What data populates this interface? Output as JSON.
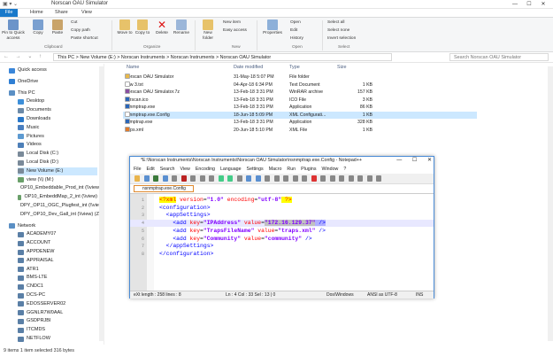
{
  "window": {
    "title": "Norscan OAU Simulator",
    "controls": [
      "—",
      "☐",
      "✕"
    ]
  },
  "ribbon_tabs": [
    "File",
    "Home",
    "Share",
    "View"
  ],
  "ribbon": {
    "pin_label": "Pin to Quick access",
    "copy_label": "Copy",
    "paste_label": "Paste",
    "cut_label": "Cut",
    "copy_path_label": "Copy path",
    "paste_shortcut_label": "Paste shortcut",
    "clipboard_group": "Clipboard",
    "move_to_label": "Move to",
    "copy_to_label": "Copy to",
    "delete_label": "Delete",
    "rename_label": "Rename",
    "organize_group": "Organize",
    "new_folder_label": "New folder",
    "new_item_label": "New item",
    "easy_access_label": "Easy access",
    "new_group": "New",
    "properties_label": "Properties",
    "open_label": "Open",
    "edit_label": "Edit",
    "history_label": "History",
    "open_group": "Open",
    "select_all_label": "Select all",
    "select_none_label": "Select none",
    "invert_selection_label": "Invert selection",
    "select_group": "Select"
  },
  "address": {
    "path": "This PC  >  New Volume (E:)  >  Norscan Instruments  >  Norscan Instruments  >  Norscan OAU Simulator",
    "search_placeholder": "Search Norscan OAU Simulator"
  },
  "nav": [
    {
      "label": "Quick access",
      "color": "#3a86d9"
    },
    {
      "label": "OneDrive",
      "color": "#2f7fd4"
    },
    {
      "label": "This PC",
      "color": "#5a8fc4"
    },
    {
      "label": "Desktop",
      "color": "#3d8fd9"
    },
    {
      "label": "Documents",
      "color": "#6c8aa8"
    },
    {
      "label": "Downloads",
      "color": "#2a78c9"
    },
    {
      "label": "Music",
      "color": "#4a7fc0"
    },
    {
      "label": "Pictures",
      "color": "#5d9ad1"
    },
    {
      "label": "Videos",
      "color": "#4d7fb8"
    },
    {
      "label": "Local Disk (C:)",
      "color": "#7a8a99"
    },
    {
      "label": "Local Disk (D:)",
      "color": "#7a8a99"
    },
    {
      "label": "New Volume (E:)",
      "color": "#7a8a99"
    },
    {
      "label": "view (\\\\) (M:)",
      "color": "#6aa06a"
    },
    {
      "label": "OP10_Embeddable_Prod_int (\\\\view)",
      "color": "#6aa06a"
    },
    {
      "label": "OP10_EmbeddMap_2_int (\\\\view)",
      "color": "#6aa06a"
    },
    {
      "label": "DPY_OP11_OGC_Plugfest_int (\\\\view)",
      "color": "#6aa06a"
    },
    {
      "label": "DPY_OP10_Dev_Gall_int (\\\\view) (Z:)",
      "color": "#6aa06a"
    },
    {
      "label": "Network",
      "color": "#5a8fc4"
    },
    {
      "label": "ACADEMY07",
      "color": "#5a7fa6"
    },
    {
      "label": "ACCOUNT",
      "color": "#5a7fa6"
    },
    {
      "label": "APPDENEW",
      "color": "#5a7fa6"
    },
    {
      "label": "APPRAISAL",
      "color": "#5a7fa6"
    },
    {
      "label": "ATR1",
      "color": "#5a7fa6"
    },
    {
      "label": "BMS-LTE",
      "color": "#5a7fa6"
    },
    {
      "label": "CNDC1",
      "color": "#5a7fa6"
    },
    {
      "label": "DCS-PC",
      "color": "#5a7fa6"
    },
    {
      "label": "EDOSSERVER02",
      "color": "#5a7fa6"
    },
    {
      "label": "GGNLR7W0AAL",
      "color": "#5a7fa6"
    },
    {
      "label": "GSDPRJBI",
      "color": "#5a7fa6"
    },
    {
      "label": "ITCMDS",
      "color": "#5a7fa6"
    },
    {
      "label": "NETFLOW",
      "color": "#5a7fa6"
    }
  ],
  "columns": [
    "Name",
    "Date modified",
    "Type",
    "Size"
  ],
  "files": [
    {
      "name": "Norscan OAU Simulator",
      "date": "31-May-18 5:07 PM",
      "type": "File folder",
      "size": "",
      "color": "#e8b84a"
    },
    {
      "name": "new 3.txt",
      "date": "04-Apr-18 6:34 PM",
      "type": "Text Document",
      "size": "1 KB",
      "color": "#ffffff"
    },
    {
      "name": "Norscan OAU Simulator.7z",
      "date": "13-Feb-18 3:31 PM",
      "type": "WinRAR archive",
      "size": "157 KB",
      "color": "#8a4fa0"
    },
    {
      "name": "norscan.ico",
      "date": "13-Feb-18 3:31 PM",
      "type": "ICO File",
      "size": "3 KB",
      "color": "#2a66b8"
    },
    {
      "name": "nsnmptrap.exe",
      "date": "13-Feb-18 3:31 PM",
      "type": "Application",
      "size": "86 KB",
      "color": "#2a66b8"
    },
    {
      "name": "nsnmptrap.exe.Config",
      "date": "18-Jun-18 5:09 PM",
      "type": "XML Configurati...",
      "size": "1 KB",
      "color": "#ffffff"
    },
    {
      "name": "snmptrap.exe",
      "date": "13-Feb-18 3:31 PM",
      "type": "Application",
      "size": "328 KB",
      "color": "#2a66b8"
    },
    {
      "name": "traps.xml",
      "date": "20-Jun-18 5:10 PM",
      "type": "XML File",
      "size": "1 KB",
      "color": "#e07a2a"
    }
  ],
  "status": "9 items    1 item selected  316 bytes",
  "notepad": {
    "title": "*E:\\Norscan Instruments\\Norscan Instruments\\Norscan OAU Simulator\\nsnmptrap.exe.Config - Notepad++",
    "menu": [
      "File",
      "Edit",
      "Search",
      "View",
      "Encoding",
      "Language",
      "Settings",
      "Macro",
      "Run",
      "Plugins",
      "Window",
      "?"
    ],
    "tab": "nsnmptrap.exe.Config",
    "lines": [
      {
        "n": "1",
        "indent": "",
        "tag1": "<?xml",
        "parts": [
          [
            " version",
            "=",
            "\"1.0\""
          ],
          [
            " encoding",
            "=",
            "\"utf-8\""
          ]
        ],
        "end": " ?>"
      },
      {
        "n": "2",
        "indent": "",
        "tag1": "<configuration>",
        "parts": [],
        "end": ""
      },
      {
        "n": "3",
        "indent": "  ",
        "tag1": "<appSettings>",
        "parts": [],
        "end": ""
      },
      {
        "n": "4",
        "indent": "    ",
        "tag1": "<add",
        "parts": [
          [
            " key",
            "=",
            "\"IPAddress\""
          ],
          [
            " value",
            "=",
            "\"172.16.129.37\""
          ]
        ],
        "end": " />"
      },
      {
        "n": "5",
        "indent": "    ",
        "tag1": "<add",
        "parts": [
          [
            " key",
            "=",
            "\"TrapsFileName\""
          ],
          [
            " value",
            "=",
            "\"traps.xml\""
          ]
        ],
        "end": " />"
      },
      {
        "n": "6",
        "indent": "    ",
        "tag1": "<add",
        "parts": [
          [
            " key",
            "=",
            "\"Community\""
          ],
          [
            " value",
            "=",
            "\"community\""
          ]
        ],
        "end": " />"
      },
      {
        "n": "7",
        "indent": "  ",
        "tag1": "</appSettings>",
        "parts": [],
        "end": ""
      },
      {
        "n": "8",
        "indent": "",
        "tag1": "</configuration>",
        "parts": [],
        "end": ""
      }
    ],
    "status": {
      "length": "eXt length : 258    lines : 8",
      "pos": "Ln : 4    Col : 33    Sel : 13 | 0",
      "eol": "Dos\\Windows",
      "enc": "ANSI as UTF-8",
      "ins": "INS"
    }
  }
}
